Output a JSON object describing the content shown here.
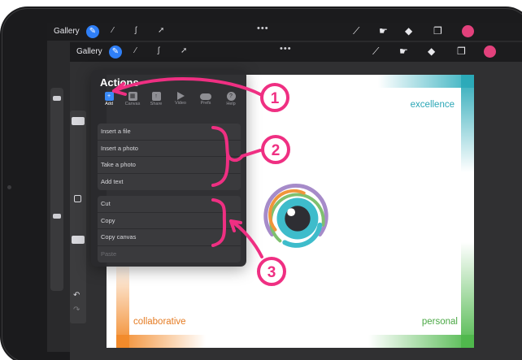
{
  "toolbar": {
    "gallery_label": "Gallery",
    "overflow_label": "•••",
    "accent_color": "#e2417c",
    "active_tool_color": "#2f7ff7"
  },
  "actions_panel": {
    "title": "Actions",
    "tabs": [
      {
        "label": "Add",
        "icon": "add-icon",
        "active": true
      },
      {
        "label": "Canvas",
        "icon": "canvas-icon",
        "active": false
      },
      {
        "label": "Share",
        "icon": "share-icon",
        "active": false
      },
      {
        "label": "Video",
        "icon": "video-play-icon",
        "active": false
      },
      {
        "label": "Prefs",
        "icon": "prefs-toggle-icon",
        "active": false
      },
      {
        "label": "Help",
        "icon": "help-icon",
        "active": false
      }
    ],
    "add_group": [
      "Insert a file",
      "Insert a photo",
      "Take a photo",
      "Add text"
    ],
    "clipboard_group": [
      "Cut",
      "Copy",
      "Copy canvas",
      "Paste"
    ]
  },
  "canvas": {
    "label_excellence": "excellence",
    "label_collaborative": "collaborative",
    "label_personal": "personal",
    "colors": {
      "teal": "#2aa6b6",
      "orange": "#e57b22",
      "green": "#4aa844",
      "purple": "#a68bc9"
    }
  },
  "annotations": {
    "marker_1": "1",
    "marker_2": "2",
    "marker_3": "3",
    "color": "#ef2f82"
  }
}
